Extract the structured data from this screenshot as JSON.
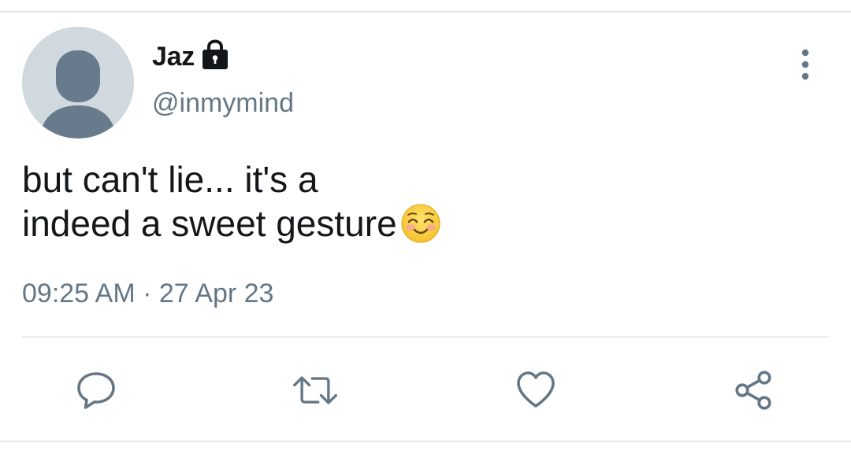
{
  "tweet": {
    "author": {
      "display_name": "Jaz",
      "handle": "@inmymind",
      "protected_icon": "lock-icon",
      "avatar_icon": "default-avatar-icon"
    },
    "text_lines": [
      "but can't lie... it's a",
      "indeed a sweet gesture"
    ],
    "emoji": "smiling-face-with-smiling-eyes",
    "timestamp": {
      "time": "09:25 AM",
      "separator": "·",
      "date": "27 Apr 23"
    }
  },
  "actions": [
    {
      "name": "reply",
      "icon": "reply-icon"
    },
    {
      "name": "retweet",
      "icon": "retweet-icon"
    },
    {
      "name": "like",
      "icon": "like-icon"
    },
    {
      "name": "share",
      "icon": "share-icon"
    }
  ],
  "colors": {
    "text_primary": "#14171a",
    "text_secondary": "#657786",
    "divider": "#e6ecf0",
    "avatar_bg": "#cfd9de",
    "avatar_fg": "#687b8c"
  }
}
